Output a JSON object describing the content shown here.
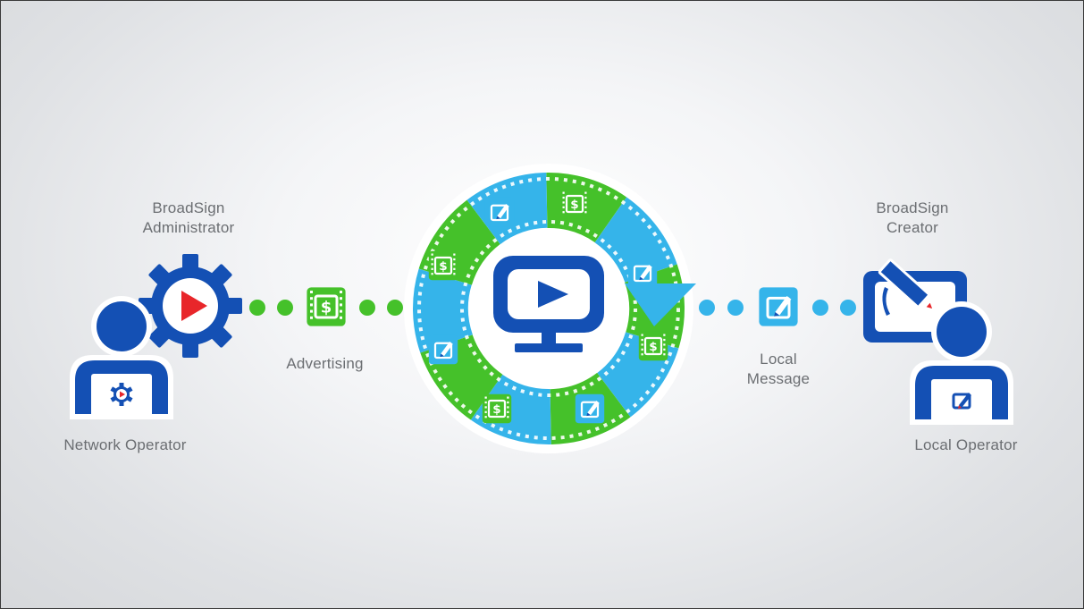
{
  "colors": {
    "blue_dark": "#1450b4",
    "blue_light": "#35b4ea",
    "green": "#45c12a",
    "red": "#e8262a",
    "white": "#ffffff",
    "label_gray": "#6b6e72"
  },
  "left": {
    "administrator": {
      "line1": "BroadSign",
      "line2": "Administrator",
      "icon": "gear-play-icon"
    },
    "network_operator": {
      "label": "Network Operator",
      "icon": "operator-laptop-gear-icon"
    },
    "advertising": {
      "label": "Advertising",
      "icon": "dollar-film-icon"
    }
  },
  "center": {
    "icon": "monitor-play-icon",
    "ring_icons": [
      "dollar-film-icon",
      "edit-message-icon"
    ]
  },
  "right": {
    "local_message": {
      "line1": "Local",
      "line2": "Message",
      "icon": "edit-message-icon"
    },
    "creator": {
      "line1": "BroadSign",
      "line2": "Creator",
      "icon": "screen-pencil-icon"
    },
    "local_operator": {
      "label": "Local Operator",
      "icon": "operator-laptop-edit-icon"
    }
  }
}
